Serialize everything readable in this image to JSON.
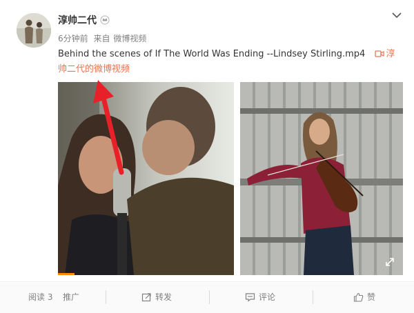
{
  "header": {
    "user_name": "淳帅二代",
    "time": "6分钟前",
    "from_label": "来自",
    "source": "微博视频"
  },
  "post": {
    "text": "Behind the scenes of If The World Was Ending --Lindsey Stirling.mp4",
    "video_link_label": "淳帅二代的微博视频"
  },
  "actions": {
    "reads": "阅读 3",
    "promote": "推广",
    "repost": "转发",
    "comment": "评论",
    "like": "赞"
  },
  "colors": {
    "accent": "#eb7350",
    "annotation_arrow": "#e8202a",
    "progress": "#ff8a00",
    "meta_text": "#808080"
  },
  "video": {
    "progress_fraction": 0.05
  },
  "icons": [
    "vip-badge-icon",
    "chevron-down-icon",
    "video-icon",
    "expand-icon",
    "repost-icon",
    "comment-icon",
    "like-icon"
  ]
}
